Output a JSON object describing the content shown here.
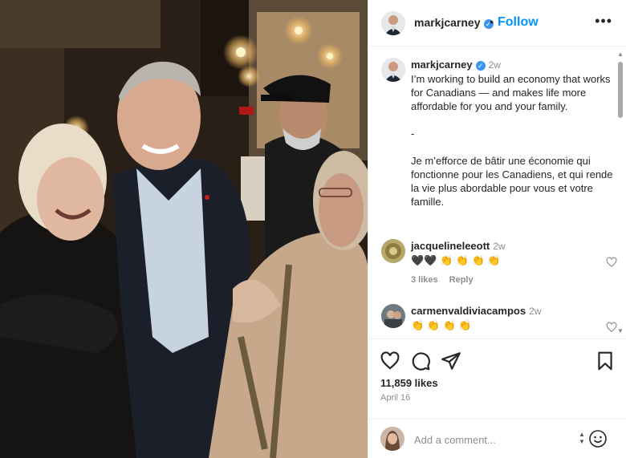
{
  "post": {
    "username": "markjcarney",
    "follow_label": "Follow",
    "dot": "•",
    "more_label": "•••"
  },
  "caption": {
    "username": "markjcarney",
    "time": "2w",
    "line1": "I’m working to build an economy that works for Canadians — and makes life more affordable for you and your family.",
    "separator": "-",
    "line2": "Je m’efforce de bâtir une économie qui fonctionne pour les Canadiens, et qui rende la vie plus abordable pour vous et votre famille."
  },
  "comments": [
    {
      "username": "jacquelineleeott",
      "time": "2w",
      "text": "🖤🖤 👏 👏 👏 👏",
      "likes": "3 likes",
      "reply": "Reply"
    },
    {
      "username": "carmenvaldiviacampos",
      "time": "2w",
      "text": "👏 👏 👏 👏"
    }
  ],
  "stats": {
    "likes": "11,859 likes",
    "date": "April 16"
  },
  "add_comment": {
    "placeholder": "Add a comment..."
  },
  "icons": {
    "like": "heart-icon",
    "comment": "comment-bubble-icon",
    "share": "send-icon",
    "save": "bookmark-icon",
    "emoji": "smiley-icon",
    "verified": "verified-badge-icon"
  },
  "colors": {
    "follow": "#0095f6",
    "verified": "#3897f0",
    "muted": "#8e8e8e"
  }
}
